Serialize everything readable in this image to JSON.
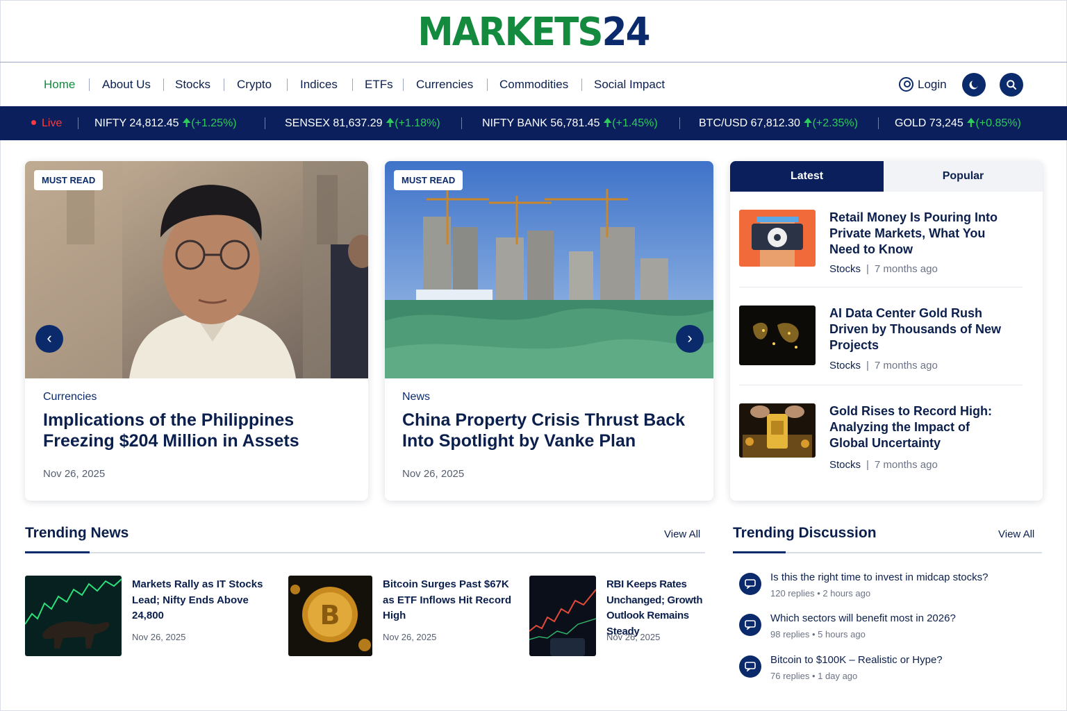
{
  "brand": {
    "logo_green": "MARKETS",
    "logo_blue": "24",
    "green": "#138a3e",
    "navy": "#0b2a6b"
  },
  "nav": {
    "items": [
      "Home",
      "About Us",
      "Stocks",
      "Crypto",
      "Indices",
      "ETFs",
      "Currencies",
      "Commodities",
      "Social Impact"
    ],
    "active": "Home",
    "login": "Login",
    "icons": [
      "user-icon",
      "moon-icon",
      "search-icon"
    ]
  },
  "ticker": {
    "live": "Live",
    "items": [
      {
        "name": "NIFTY 24,812.45",
        "change": "(+1.25%)"
      },
      {
        "name": "SENSEX 81,637.29",
        "change": "(+1.18%)"
      },
      {
        "name": "NIFTY BANK 56,781.45",
        "change": "(+1.45%)"
      },
      {
        "name": "BTC/USD 67,812.30",
        "change": "(+2.35%)"
      },
      {
        "name": "GOLD 73,245",
        "change": "(+0.85%)"
      }
    ],
    "up_color": "#2ecc5a"
  },
  "hero": [
    {
      "badge": "MUST READ",
      "category": "Currencies",
      "title": "Implications of the Philippines Freezing $204 Million in Assets",
      "date": "Nov 26, 2025"
    },
    {
      "badge": "MUST READ",
      "category": "News",
      "title": "China Property Crisis Thrust Back Into Spotlight by Vanke Plan",
      "date": "Nov 26, 2025"
    }
  ],
  "side": {
    "tabs": [
      "Latest",
      "Popular"
    ],
    "items": [
      {
        "title": "Retail Money Is Pouring Into Private Markets, What You Need to Know",
        "category": "Stocks",
        "ago": "7 months ago"
      },
      {
        "title": "AI Data Center Gold Rush Driven by Thousands of New Projects",
        "category": "Stocks",
        "ago": "7 months ago"
      },
      {
        "title": "Gold Rises to Record High: Analyzing the Impact of Global Uncertainty",
        "category": "Stocks",
        "ago": "7 months ago"
      }
    ]
  },
  "trending": {
    "title": "Trending News",
    "view_all": "View All",
    "items": [
      {
        "title": "Markets Rally as IT Stocks Lead; Nifty Ends Above 24,800",
        "date": "Nov 26, 2025"
      },
      {
        "title": "Bitcoin Surges Past $67K as ETF Inflows Hit Record High",
        "date": "Nov 26, 2025"
      },
      {
        "title": "RBI Keeps Rates Unchanged; Growth Outlook Remains Steady",
        "date": "Nov 26, 2025"
      }
    ]
  },
  "discussion": {
    "title": "Trending Discussion",
    "view_all": "View All",
    "items": [
      {
        "question": "Is this the right time to invest in midcap stocks?",
        "replies": "120 replies",
        "ago": "2 hours ago"
      },
      {
        "question": "Which sectors will benefit most in 2026?",
        "replies": "98 replies",
        "ago": "5 hours ago"
      },
      {
        "question": "Bitcoin to $100K – Realistic or Hype?",
        "replies": "76 replies",
        "ago": "1 day ago"
      }
    ]
  }
}
